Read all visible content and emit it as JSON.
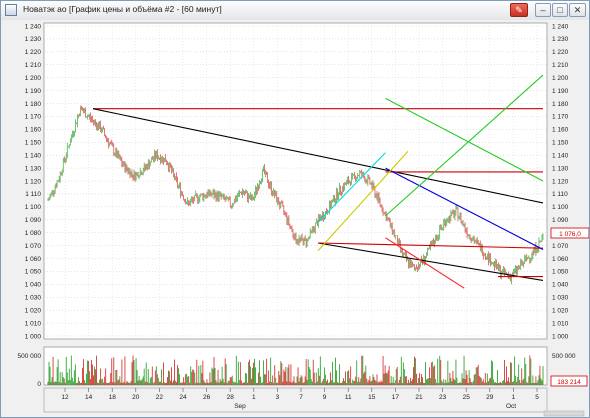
{
  "window": {
    "title": "Новатэк ао [График цены и объёма #2 - [60 минут]"
  },
  "icons": {
    "app": "chart-window-icon",
    "pin": "pin-icon",
    "minimize": "minimize-icon",
    "maximize": "maximize-icon",
    "close": "close-icon"
  },
  "chart_data": {
    "type": "candlestick",
    "price_axis": {
      "ticks": [
        "1 000",
        "1 010",
        "1 020",
        "1 030",
        "1 040",
        "1 050",
        "1 060",
        "1 070",
        "1 080",
        "1 090",
        "1 100",
        "1 110",
        "1 120",
        "1 130",
        "1 140",
        "1 150",
        "1 160",
        "1 170",
        "1 180",
        "1 190",
        "1 200",
        "1 210",
        "1 220",
        "1 230",
        "1 240"
      ],
      "ylim": [
        1000,
        1240
      ],
      "last_price_label": "1 076,0"
    },
    "volume_axis": {
      "ticks": [
        "0",
        "500 000"
      ],
      "last_volume_label": "183 214"
    },
    "date_axis": {
      "day_ticks": [
        "12",
        "14",
        "18",
        "20",
        "22",
        "24",
        "26",
        "28",
        "1",
        "3",
        "7",
        "9",
        "11",
        "15",
        "17",
        "21",
        "23",
        "25",
        "29",
        "1",
        "5"
      ],
      "month_labels": [
        "Sep",
        "Oct"
      ]
    },
    "price_series_approx": [
      {
        "day": "11 Sep",
        "close": 1105
      },
      {
        "day": "12 Sep",
        "close": 1122
      },
      {
        "day": "13 Sep",
        "close": 1150
      },
      {
        "day": "14 Sep",
        "close": 1176
      },
      {
        "day": "15 Sep",
        "close": 1168
      },
      {
        "day": "18 Sep",
        "close": 1160
      },
      {
        "day": "19 Sep",
        "close": 1145
      },
      {
        "day": "20 Sep",
        "close": 1132
      },
      {
        "day": "21 Sep",
        "close": 1124
      },
      {
        "day": "22 Sep",
        "close": 1130
      },
      {
        "day": "25 Sep",
        "close": 1140
      },
      {
        "day": "26 Sep",
        "close": 1136
      },
      {
        "day": "27 Sep",
        "close": 1118
      },
      {
        "day": "28 Sep",
        "close": 1102
      },
      {
        "day": "29 Sep",
        "close": 1108
      },
      {
        "day": "2 Oct",
        "close": 1110
      },
      {
        "day": "3 Oct",
        "close": 1108
      },
      {
        "day": "4 Oct",
        "close": 1102
      },
      {
        "day": "5 Oct",
        "close": 1112
      },
      {
        "day": "6 Oct",
        "close": 1105
      },
      {
        "day": "9 Oct",
        "close": 1128
      },
      {
        "day": "10 Oct",
        "close": 1110
      },
      {
        "day": "11 Oct",
        "close": 1095
      },
      {
        "day": "12 Oct",
        "close": 1075
      },
      {
        "day": "13 Oct",
        "close": 1073
      },
      {
        "day": "16 Oct",
        "close": 1088
      },
      {
        "day": "17 Oct",
        "close": 1098
      },
      {
        "day": "18 Oct",
        "close": 1112
      },
      {
        "day": "19 Oct",
        "close": 1120
      },
      {
        "day": "20 Oct",
        "close": 1126
      },
      {
        "day": "23 Oct",
        "close": 1118
      },
      {
        "day": "24 Oct",
        "close": 1100
      },
      {
        "day": "25 Oct",
        "close": 1082
      },
      {
        "day": "26 Oct",
        "close": 1062
      },
      {
        "day": "27 Oct",
        "close": 1052
      },
      {
        "day": "30 Oct",
        "close": 1060
      },
      {
        "day": "31 Oct",
        "close": 1075
      },
      {
        "day": "1 Nov",
        "close": 1090
      },
      {
        "day": "2 Nov",
        "close": 1096
      },
      {
        "day": "3 Nov",
        "close": 1080
      },
      {
        "day": "6 Nov",
        "close": 1070
      },
      {
        "day": "7 Nov",
        "close": 1060
      },
      {
        "day": "8 Nov",
        "close": 1050
      },
      {
        "day": "9 Nov",
        "close": 1046
      },
      {
        "day": "10 Nov",
        "close": 1055
      },
      {
        "day": "13 Nov",
        "close": 1064
      },
      {
        "day": "14 Nov",
        "close": 1076
      }
    ],
    "trendlines": [
      {
        "color": "#cc0000",
        "from": [
          14,
          1176
        ],
        "to": [
          54,
          1176
        ]
      },
      {
        "color": "#000000",
        "from": [
          14,
          1176
        ],
        "to": [
          54,
          1103
        ]
      },
      {
        "color": "#000000",
        "from": [
          34,
          1072
        ],
        "to": [
          54,
          1043
        ]
      },
      {
        "color": "#cc0000",
        "from": [
          34,
          1072
        ],
        "to": [
          54,
          1068
        ]
      },
      {
        "color": "#cc0000",
        "from": [
          40,
          1127
        ],
        "to": [
          54,
          1127
        ]
      },
      {
        "color": "#0000dd",
        "from": [
          40,
          1130
        ],
        "to": [
          54,
          1067
        ]
      },
      {
        "color": "#00dddd",
        "from": [
          34,
          1088
        ],
        "to": [
          40,
          1142
        ]
      },
      {
        "color": "#cccc00",
        "from": [
          34,
          1066
        ],
        "to": [
          42,
          1143
        ]
      },
      {
        "color": "#22cc22",
        "from": [
          40,
          1093
        ],
        "to": [
          54,
          1202
        ]
      },
      {
        "color": "#22cc22",
        "from": [
          40,
          1184
        ],
        "to": [
          54,
          1120
        ]
      },
      {
        "color": "#ff2222",
        "from": [
          40,
          1076
        ],
        "to": [
          47,
          1037
        ]
      },
      {
        "color": "#cc0000",
        "from": [
          50,
          1046
        ],
        "to": [
          54,
          1046
        ]
      }
    ]
  }
}
